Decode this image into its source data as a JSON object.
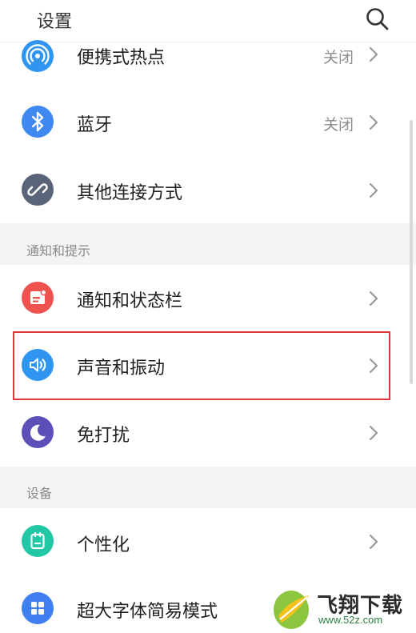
{
  "header": {
    "title": "设置"
  },
  "rows": {
    "hotspot": {
      "label": "便携式热点",
      "value": "关闭"
    },
    "bluetooth": {
      "label": "蓝牙",
      "value": "关闭"
    },
    "other_connect": {
      "label": "其他连接方式"
    },
    "notifications": {
      "label": "通知和状态栏"
    },
    "sound": {
      "label": "声音和振动"
    },
    "dnd": {
      "label": "免打扰"
    },
    "personalize": {
      "label": "个性化"
    },
    "large_font": {
      "label": "超大字体简易模式"
    }
  },
  "sections": {
    "notify": "通知和提示",
    "device": "设备"
  },
  "icons": {
    "hotspot": "hotspot-icon",
    "bluetooth": "bluetooth-icon",
    "other_connect": "link-icon",
    "notifications": "notification-icon",
    "sound": "speaker-icon",
    "dnd": "moon-icon",
    "personalize": "personalize-icon",
    "large_font": "grid-icon"
  },
  "colors": {
    "hotspot": "#2f95f0",
    "bluetooth": "#3f88f2",
    "other_connect": "#5a6478",
    "notifications": "#ef5350",
    "sound": "#2f95f0",
    "dnd": "#5b4fb8",
    "personalize": "#22c7a6",
    "large_font": "#3f7ff0",
    "highlight": "#e0353b"
  },
  "watermark": {
    "brand": "飞翔下载",
    "url": "www.52z.com"
  }
}
